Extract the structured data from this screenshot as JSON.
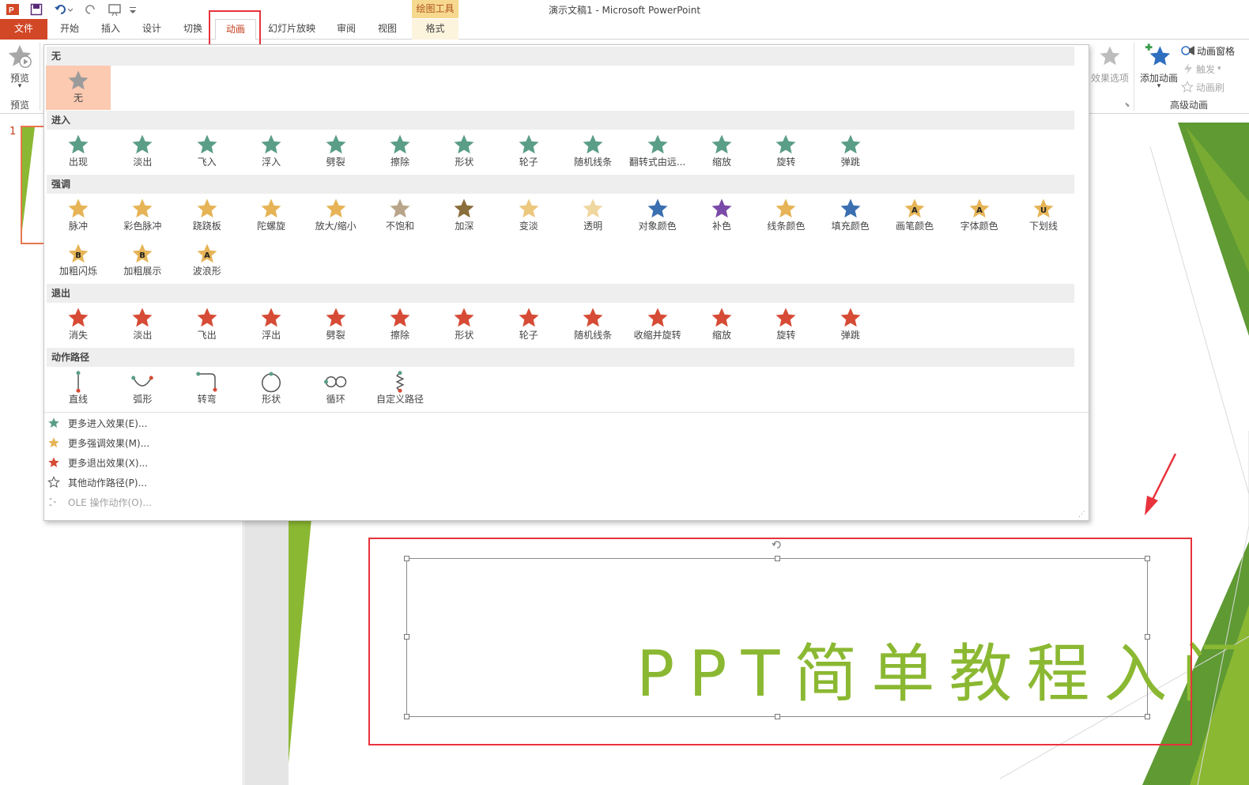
{
  "window": {
    "title": "演示文稿1 - Microsoft PowerPoint",
    "tool_tab_title": "绘图工具"
  },
  "tabs": [
    {
      "label": "文件"
    },
    {
      "label": "开始"
    },
    {
      "label": "插入"
    },
    {
      "label": "设计"
    },
    {
      "label": "切换"
    },
    {
      "label": "动画"
    },
    {
      "label": "幻灯片放映"
    },
    {
      "label": "审阅"
    },
    {
      "label": "视图"
    },
    {
      "label": "格式"
    }
  ],
  "ribbon": {
    "preview_button": "预览",
    "preview_group": "预览",
    "effect_options": "效果选项",
    "add_animation": "添加动画",
    "animation_pane": "动画窗格",
    "trigger": "触发",
    "animation_painter": "动画刷",
    "advanced_group": "高级动画"
  },
  "slide_pane": {
    "slide_number": "1"
  },
  "slide": {
    "title_text": "PPT简单教程入门"
  },
  "gallery": {
    "none": {
      "header": "无",
      "items": [
        {
          "label": "无"
        }
      ]
    },
    "entrance": {
      "header": "进入",
      "items": [
        {
          "label": "出现"
        },
        {
          "label": "淡出"
        },
        {
          "label": "飞入"
        },
        {
          "label": "浮入"
        },
        {
          "label": "劈裂"
        },
        {
          "label": "擦除"
        },
        {
          "label": "形状"
        },
        {
          "label": "轮子"
        },
        {
          "label": "随机线条"
        },
        {
          "label": "翻转式由远..."
        },
        {
          "label": "缩放"
        },
        {
          "label": "旋转"
        },
        {
          "label": "弹跳"
        }
      ]
    },
    "emphasis": {
      "header": "强调",
      "items": [
        {
          "label": "脉冲"
        },
        {
          "label": "彩色脉冲"
        },
        {
          "label": "跷跷板"
        },
        {
          "label": "陀螺旋"
        },
        {
          "label": "放大/缩小"
        },
        {
          "label": "不饱和"
        },
        {
          "label": "加深"
        },
        {
          "label": "变淡"
        },
        {
          "label": "透明"
        },
        {
          "label": "对象颜色"
        },
        {
          "label": "补色"
        },
        {
          "label": "线条颜色"
        },
        {
          "label": "填充颜色"
        },
        {
          "label": "画笔颜色"
        },
        {
          "label": "字体颜色"
        },
        {
          "label": "下划线"
        },
        {
          "label": "加粗闪烁"
        },
        {
          "label": "加粗展示"
        },
        {
          "label": "波浪形"
        }
      ]
    },
    "exit": {
      "header": "退出",
      "items": [
        {
          "label": "消失"
        },
        {
          "label": "淡出"
        },
        {
          "label": "飞出"
        },
        {
          "label": "浮出"
        },
        {
          "label": "劈裂"
        },
        {
          "label": "擦除"
        },
        {
          "label": "形状"
        },
        {
          "label": "轮子"
        },
        {
          "label": "随机线条"
        },
        {
          "label": "收缩并旋转"
        },
        {
          "label": "缩放"
        },
        {
          "label": "旋转"
        },
        {
          "label": "弹跳"
        }
      ]
    },
    "motion": {
      "header": "动作路径",
      "items": [
        {
          "label": "直线"
        },
        {
          "label": "弧形"
        },
        {
          "label": "转弯"
        },
        {
          "label": "形状"
        },
        {
          "label": "循环"
        },
        {
          "label": "自定义路径"
        }
      ]
    },
    "more": [
      {
        "label": "更多进入效果(E)..."
      },
      {
        "label": "更多强调效果(M)..."
      },
      {
        "label": "更多退出效果(X)..."
      },
      {
        "label": "其他动作路径(P)..."
      },
      {
        "label": "OLE 操作动作(O)..."
      }
    ]
  },
  "colors": {
    "accent": "#d24726",
    "entrance_green": "#5b9e87",
    "emphasis_gold": "#e6b457",
    "exit_red": "#d64b35",
    "slide_green": "#8bb832",
    "highlight_red": "#e8323c"
  }
}
